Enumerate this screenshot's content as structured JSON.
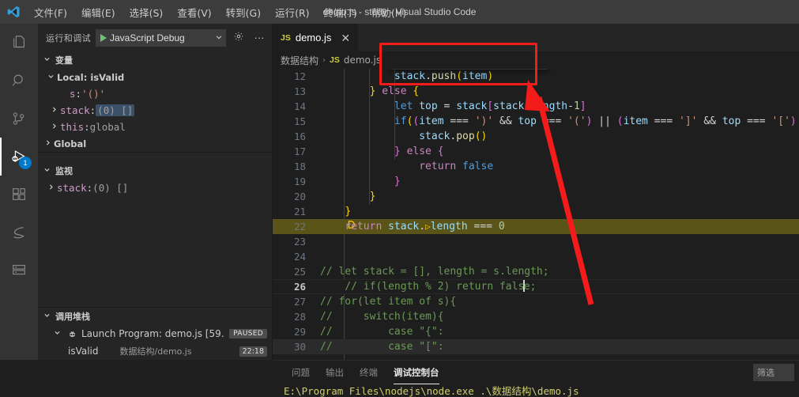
{
  "window": {
    "title": "demo.js - study - Visual Studio Code",
    "logo_icon": "vscode-logo-icon"
  },
  "menubar": {
    "items": [
      {
        "label": "文件(F)",
        "name": "menu-file"
      },
      {
        "label": "编辑(E)",
        "name": "menu-edit"
      },
      {
        "label": "选择(S)",
        "name": "menu-selection"
      },
      {
        "label": "查看(V)",
        "name": "menu-view"
      },
      {
        "label": "转到(G)",
        "name": "menu-goto"
      },
      {
        "label": "运行(R)",
        "name": "menu-run"
      },
      {
        "label": "终端(T)",
        "name": "menu-terminal"
      },
      {
        "label": "帮助(H)",
        "name": "menu-help"
      }
    ]
  },
  "activitybar": {
    "items": [
      {
        "icon": "files-explorer-icon",
        "name": "activity-explorer",
        "active": false,
        "badge": ""
      },
      {
        "icon": "search-icon",
        "name": "activity-search",
        "active": false,
        "badge": ""
      },
      {
        "icon": "source-control-icon",
        "name": "activity-source-control",
        "active": false,
        "badge": ""
      },
      {
        "icon": "run-and-debug-icon",
        "name": "activity-run-debug",
        "active": true,
        "badge": "1"
      },
      {
        "icon": "extensions-icon",
        "name": "activity-extensions",
        "active": false,
        "badge": ""
      },
      {
        "icon": "sourcegraph-icon",
        "name": "activity-sourcegraph",
        "active": false,
        "badge": ""
      },
      {
        "icon": "database-icon",
        "name": "activity-database",
        "active": false,
        "badge": ""
      }
    ],
    "badge_color": "#007acc"
  },
  "sidebar": {
    "header": {
      "title": "运行和调试",
      "launch_config": "JavaScript Debug",
      "play_icon": "play-icon",
      "dropdown_icon": "chevron-down-icon",
      "gear_icon": "gear-icon",
      "more_icon": "more-actions-icon"
    },
    "variables": {
      "section_label": "变量",
      "scopes": [
        {
          "label": "Local: isValid",
          "expanded": true,
          "name": "scope-local-isvalid",
          "children": [
            {
              "name": "s",
              "sep": ": ",
              "value": "'()'",
              "kind": "string",
              "expandable": false,
              "highlight": false
            },
            {
              "name": "stack",
              "sep": ": ",
              "value": "(0) []",
              "kind": "plain",
              "expandable": true,
              "highlight": true
            },
            {
              "name": "this",
              "sep": ": ",
              "value": "global",
              "kind": "plain",
              "expandable": true,
              "highlight": false
            }
          ]
        },
        {
          "label": "Global",
          "expanded": false,
          "name": "scope-global",
          "children": []
        }
      ]
    },
    "watch": {
      "section_label": "监视",
      "items": [
        {
          "name": "stack",
          "sep": ": ",
          "value": "(0) []",
          "expandable": true
        }
      ]
    },
    "callstack": {
      "section_label": "调用堆栈",
      "session": {
        "label": "Launch Program: demo.js [59…",
        "status": "PAUSED",
        "icon": "debug-session-icon"
      },
      "frames": [
        {
          "name": "isValid",
          "source": "数据结构/demo.js",
          "position": "22:18"
        }
      ]
    }
  },
  "editor": {
    "tab": {
      "label": "demo.js",
      "file_icon": "js-file-icon",
      "close_icon": "close-icon"
    },
    "breadcrumb": {
      "folder": "数据结构",
      "separator": "›",
      "file": "demo.js",
      "file_icon": "js-file-icon"
    },
    "current_line": 22,
    "cursor_line": 26,
    "cursor_position": "22:18",
    "lines": [
      {
        "num": 12,
        "indent": 12,
        "text": "stack.push(item)",
        "state": "normal"
      },
      {
        "num": 13,
        "indent": 8,
        "text": "} else {",
        "state": "normal"
      },
      {
        "num": 14,
        "indent": 12,
        "text": "let top = stack[stack.length-1]",
        "state": "normal"
      },
      {
        "num": 15,
        "indent": 12,
        "text": "if((item === ')' && top === '(') || (item === ']' && top === '[') |",
        "state": "normal"
      },
      {
        "num": 16,
        "indent": 16,
        "text": "stack.pop()",
        "state": "normal"
      },
      {
        "num": 17,
        "indent": 12,
        "text": "} else {",
        "state": "normal"
      },
      {
        "num": 18,
        "indent": 16,
        "text": "return false",
        "state": "normal"
      },
      {
        "num": 19,
        "indent": 12,
        "text": "}",
        "state": "normal"
      },
      {
        "num": 20,
        "indent": 8,
        "text": "}",
        "state": "normal"
      },
      {
        "num": 21,
        "indent": 4,
        "text": "}",
        "state": "normal"
      },
      {
        "num": 22,
        "indent": 4,
        "text": "return stack.length === 0",
        "state": "current"
      },
      {
        "num": 23,
        "indent": 0,
        "text": "",
        "state": "normal"
      },
      {
        "num": 24,
        "indent": 0,
        "text": "",
        "state": "normal"
      },
      {
        "num": 25,
        "indent": 4,
        "text": "// let stack = [], length = s.length;",
        "state": "normal"
      },
      {
        "num": 26,
        "indent": 4,
        "text": "// if(length % 2) return false;",
        "state": "cursor"
      },
      {
        "num": 27,
        "indent": 4,
        "text": "// for(let item of s){",
        "state": "normal"
      },
      {
        "num": 28,
        "indent": 4,
        "text": "//     switch(item){",
        "state": "normal"
      },
      {
        "num": 29,
        "indent": 4,
        "text": "//         case \"{\":",
        "state": "normal"
      },
      {
        "num": 30,
        "indent": 4,
        "text": "//         case \"[\":",
        "state": "hover"
      }
    ]
  },
  "debug_toolbar": {
    "grip_icon": "drag-handle-icon",
    "buttons": [
      {
        "icon": "continue-icon",
        "name": "debug-continue-button",
        "color": "#75beff"
      },
      {
        "icon": "step-over-icon",
        "name": "debug-step-over-button",
        "color": "#75beff"
      },
      {
        "icon": "step-into-icon",
        "name": "debug-step-into-button",
        "color": "#75beff"
      },
      {
        "icon": "step-out-icon",
        "name": "debug-step-out-button",
        "color": "#75beff"
      },
      {
        "icon": "restart-icon",
        "name": "debug-restart-button",
        "color": "#6fc26f"
      },
      {
        "icon": "stop-icon",
        "name": "debug-stop-button",
        "color": "#f48771"
      }
    ]
  },
  "annotation": {
    "color": "#f41b1b",
    "shape": "rectangle-with-arrow",
    "target": "debug-toolbar"
  },
  "panel": {
    "tabs": [
      {
        "label": "问题",
        "name": "panel-tab-problems",
        "active": false
      },
      {
        "label": "输出",
        "name": "panel-tab-output",
        "active": false
      },
      {
        "label": "终端",
        "name": "panel-tab-terminal",
        "active": false
      },
      {
        "label": "调试控制台",
        "name": "panel-tab-debug-console",
        "active": true
      }
    ],
    "filter_placeholder": "筛选",
    "console_output": "E:\\Program Files\\nodejs\\node.exe .\\数据结构\\demo.js"
  }
}
